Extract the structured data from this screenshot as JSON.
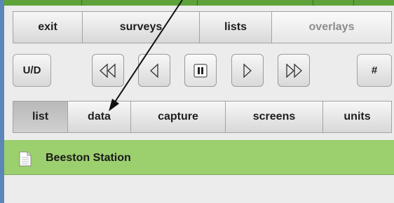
{
  "nav_row": {
    "exit": "exit",
    "surveys": "surveys",
    "lists": "lists",
    "overlays": "overlays"
  },
  "control_row": {
    "ud": "U/D",
    "hash": "#"
  },
  "tabs": {
    "list": "list",
    "data": "data",
    "capture": "capture",
    "screens": "screens",
    "units": "units"
  },
  "station": {
    "name": "Beeston Station"
  },
  "icons": {
    "rewind": "rewind-icon",
    "step_back": "step-back-icon",
    "pause": "pause-icon",
    "step_forward": "step-forward-icon",
    "fast_forward": "fast-forward-icon",
    "document": "document-icon",
    "annotation": "annotation-arrow"
  },
  "colors": {
    "accent_green": "#5ea33a",
    "row_green": "#9ccf6e",
    "left_strip": "#5b86b8"
  }
}
